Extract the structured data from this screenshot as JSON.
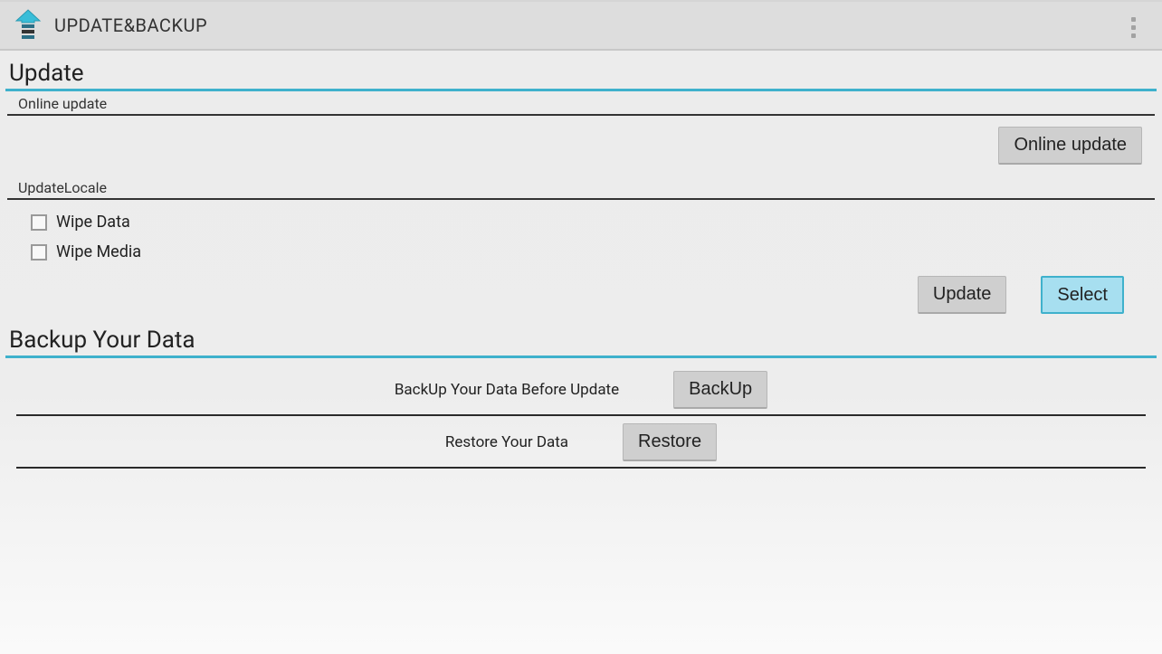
{
  "header": {
    "app_title": "UPDATE&BACKUP"
  },
  "update": {
    "section_title": "Update",
    "online_update_header": "Online update",
    "online_update_button": "Online update",
    "update_locale_header": "UpdateLocale",
    "wipe_data_label": "Wipe Data",
    "wipe_data_checked": false,
    "wipe_media_label": "Wipe Media",
    "wipe_media_checked": false,
    "update_button": "Update",
    "select_button": "Select"
  },
  "backup": {
    "section_title": "Backup Your Data",
    "backup_label": "BackUp Your Data Before Update",
    "backup_button": "BackUp",
    "restore_label": "Restore Your Data",
    "restore_button": "Restore"
  },
  "colors": {
    "accent": "#3fb1cc",
    "button_bg": "#cfcfcf",
    "bar_bg": "#dddddd"
  }
}
